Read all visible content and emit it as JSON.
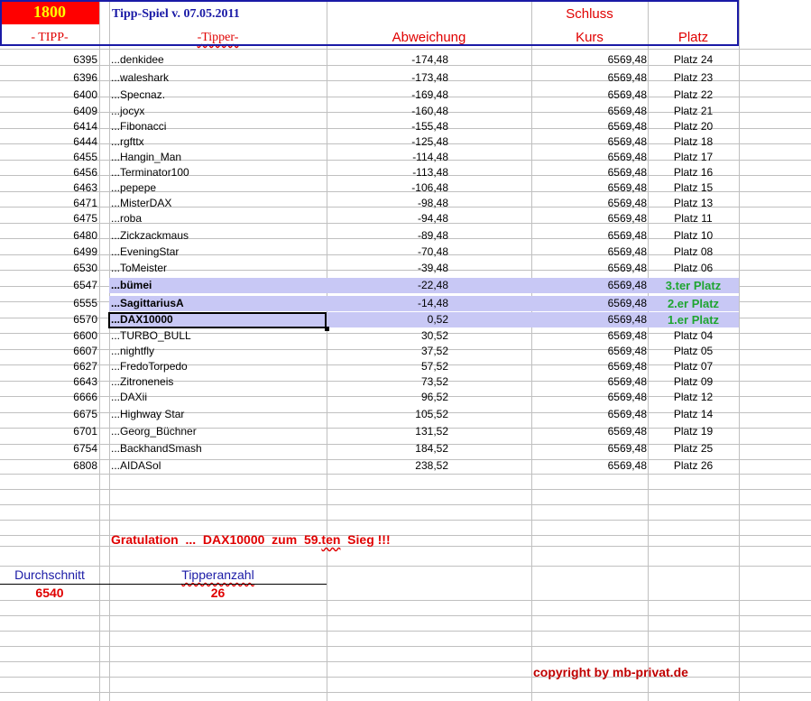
{
  "header": {
    "tipp_count": "1800",
    "title": "Tipp-Spiel v. 07.05.2011",
    "schluss_label": "Schluss",
    "col_tipp": "- TIPP-",
    "col_tipper": "-Tipper-",
    "col_abweichung": "Abweichung",
    "col_kurs": "Kurs",
    "col_platz": "Platz"
  },
  "rows": [
    {
      "tipp": "6395",
      "name": "...denkidee",
      "abw": "-174,48",
      "kurs": "6569,48",
      "platz": "Platz 24"
    },
    {
      "tipp": "6396",
      "name": "...waleshark",
      "abw": "-173,48",
      "kurs": "6569,48",
      "platz": "Platz 23"
    },
    {
      "tipp": "6400",
      "name": "...Specnaz.",
      "abw": "-169,48",
      "kurs": "6569,48",
      "platz": "Platz 22"
    },
    {
      "tipp": "6409",
      "name": "...jocyx",
      "abw": "-160,48",
      "kurs": "6569,48",
      "platz": "Platz 21"
    },
    {
      "tipp": "6414",
      "name": "...Fibonacci",
      "abw": "-155,48",
      "kurs": "6569,48",
      "platz": "Platz 20"
    },
    {
      "tipp": "6444",
      "name": "...rgfttx",
      "abw": "-125,48",
      "kurs": "6569,48",
      "platz": "Platz 18"
    },
    {
      "tipp": "6455",
      "name": "...Hangin_Man",
      "abw": "-114,48",
      "kurs": "6569,48",
      "platz": "Platz 17"
    },
    {
      "tipp": "6456",
      "name": "...Terminator100",
      "abw": "-113,48",
      "kurs": "6569,48",
      "platz": "Platz 16"
    },
    {
      "tipp": "6463",
      "name": "...pepepe",
      "abw": "-106,48",
      "kurs": "6569,48",
      "platz": "Platz 15"
    },
    {
      "tipp": "6471",
      "name": "...MisterDAX",
      "abw": "-98,48",
      "kurs": "6569,48",
      "platz": "Platz 13"
    },
    {
      "tipp": "6475",
      "name": "...roba",
      "abw": "-94,48",
      "kurs": "6569,48",
      "platz": "Platz 11"
    },
    {
      "tipp": "6480",
      "name": "...Zickzackmaus",
      "abw": "-89,48",
      "kurs": "6569,48",
      "platz": "Platz 10"
    },
    {
      "tipp": "6499",
      "name": "...EveningStar",
      "abw": "-70,48",
      "kurs": "6569,48",
      "platz": "Platz 08"
    },
    {
      "tipp": "6530",
      "name": "...ToMeister",
      "abw": "-39,48",
      "kurs": "6569,48",
      "platz": "Platz 06"
    },
    {
      "tipp": "6547",
      "name": "...bümei",
      "abw": "-22,48",
      "kurs": "6569,48",
      "platz": "3.ter Platz"
    },
    {
      "tipp": "6555",
      "name": "...SagittariusA",
      "abw": "-14,48",
      "kurs": "6569,48",
      "platz": "2.er Platz"
    },
    {
      "tipp": "6570",
      "name": "...DAX10000",
      "abw": "0,52",
      "kurs": "6569,48",
      "platz": "1.er Platz"
    },
    {
      "tipp": "6600",
      "name": "...TURBO_BULL",
      "abw": "30,52",
      "kurs": "6569,48",
      "platz": "Platz 04"
    },
    {
      "tipp": "6607",
      "name": "...nightfly",
      "abw": "37,52",
      "kurs": "6569,48",
      "platz": "Platz 05"
    },
    {
      "tipp": "6627",
      "name": "...FredoTorpedo",
      "abw": "57,52",
      "kurs": "6569,48",
      "platz": "Platz 07"
    },
    {
      "tipp": "6643",
      "name": "...Zitroneneis",
      "abw": "73,52",
      "kurs": "6569,48",
      "platz": "Platz 09"
    },
    {
      "tipp": "6666",
      "name": "...DAXii",
      "abw": "96,52",
      "kurs": "6569,48",
      "platz": "Platz 12"
    },
    {
      "tipp": "6675",
      "name": "...Highway Star",
      "abw": "105,52",
      "kurs": "6569,48",
      "platz": "Platz 14"
    },
    {
      "tipp": "6701",
      "name": "...Georg_Büchner",
      "abw": "131,52",
      "kurs": "6569,48",
      "platz": "Platz 19"
    },
    {
      "tipp": "6754",
      "name": "...BackhandSmash",
      "abw": "184,52",
      "kurs": "6569,48",
      "platz": "Platz 25"
    },
    {
      "tipp": "6808",
      "name": "...AIDASol",
      "abw": "238,52",
      "kurs": "6569,48",
      "platz": "Platz 26"
    }
  ],
  "congrats": {
    "part1": "Gratulation  ...  DAX10000  zum  59.",
    "part2": "ten",
    "part3": "  Sieg !!!"
  },
  "stats": {
    "avg_label": "Durchschnitt",
    "avg_value": "6540",
    "count_label": "Tipperanzahl",
    "count_value": "26"
  },
  "footer": {
    "copyright": "copyright by mb-privat.de"
  },
  "colors": {
    "header_border": "#1a1aa6",
    "highlight": "#c8c8f5",
    "winner_text": "#1fa531",
    "red": "#e00000",
    "badge_bg": "#ff0000",
    "badge_text": "#ffff00"
  }
}
